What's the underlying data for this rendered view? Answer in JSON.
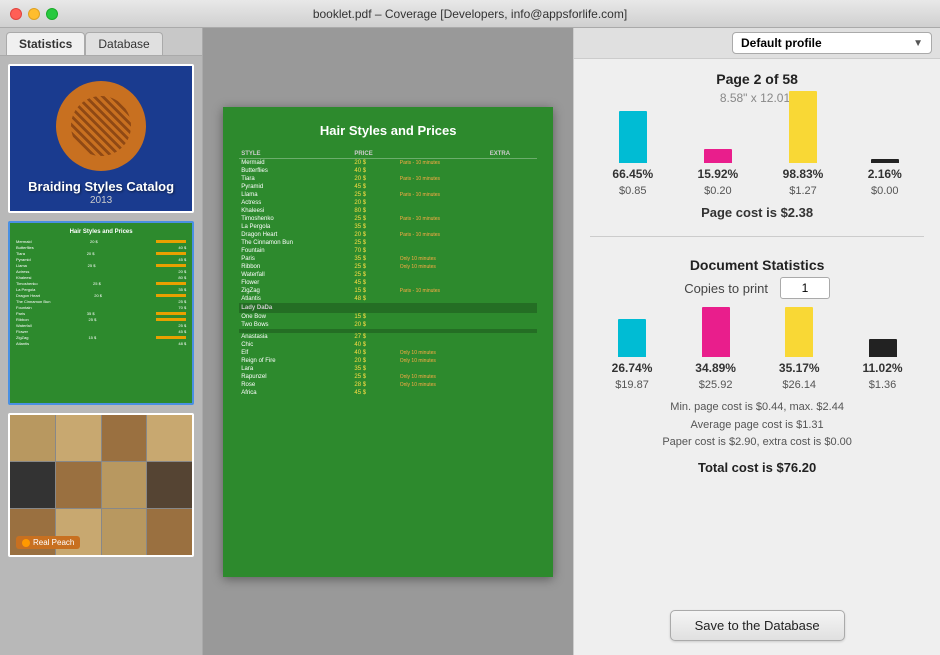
{
  "window": {
    "title": "booklet.pdf – Coverage [Developers, info@appsforlife.com]"
  },
  "tabs": {
    "statistics": "Statistics",
    "database": "Database"
  },
  "profile": {
    "label": "Default profile"
  },
  "thumbnails": [
    {
      "id": "cover",
      "type": "cover",
      "title": "Braiding Styles Catalog",
      "year": "2013"
    },
    {
      "id": "page2",
      "type": "page",
      "title": "Hair Styles and Prices"
    },
    {
      "id": "photos",
      "type": "photos",
      "badge": "Real Peach"
    }
  ],
  "preview": {
    "title": "Hair Styles and Prices",
    "items": [
      {
        "name": "Mermaid",
        "price": "20 $",
        "note": "Paris - 10 minutes"
      },
      {
        "name": "Butterflies",
        "price": "40 $",
        "note": ""
      },
      {
        "name": "Tiara",
        "price": "20 $",
        "note": "Paris - 10 minutes"
      },
      {
        "name": "Pyramid",
        "price": "45 $",
        "note": ""
      },
      {
        "name": "Llama",
        "price": "25 $",
        "note": "Paris - 10 minutes"
      },
      {
        "name": "Actress",
        "price": "20 $",
        "note": ""
      },
      {
        "name": "Khaleesi",
        "price": "80 $",
        "note": ""
      },
      {
        "name": "Timoshenko",
        "price": "25 $",
        "note": "Paris - 10 minutes"
      },
      {
        "name": "La Pergola",
        "price": "35 $",
        "note": ""
      },
      {
        "name": "Dragon Heart",
        "price": "20 $",
        "note": "Paris - 10 minutes"
      },
      {
        "name": "The Cinnamon Bun",
        "price": "25 $",
        "note": ""
      },
      {
        "name": "Fountain",
        "price": "70 $",
        "note": ""
      },
      {
        "name": "Paris",
        "price": "35 $",
        "note": "Only 10 minutes"
      },
      {
        "name": "Ribbon",
        "price": "25 $",
        "note": "Only 10 minutes"
      },
      {
        "name": "Waterfall",
        "price": "25 $",
        "note": ""
      },
      {
        "name": "Flower",
        "price": "45 $",
        "note": ""
      },
      {
        "name": "ZigZag",
        "price": "15 $",
        "note": "Paris - 10 minutes"
      },
      {
        "name": "Atlantis",
        "price": "48 $",
        "note": ""
      },
      {
        "section": "Lady DaDa"
      },
      {
        "name": "One Bow",
        "price": "15 $",
        "note": ""
      },
      {
        "name": "Two Bows",
        "price": "20 $",
        "note": ""
      },
      {
        "section": ""
      },
      {
        "name": "Anastasia",
        "price": "27 $",
        "note": ""
      },
      {
        "name": "Chic",
        "price": "40 $",
        "note": ""
      },
      {
        "name": "Elf",
        "price": "40 $",
        "note": "Only 10 minutes"
      },
      {
        "name": "Reign of Fire",
        "price": "20 $",
        "note": "Only 10 minutes"
      },
      {
        "name": "Lara",
        "price": "35 $",
        "note": ""
      },
      {
        "name": "Rapunzel",
        "price": "25 $",
        "note": "Only 10 minutes"
      },
      {
        "name": "Rose",
        "price": "28 $",
        "note": "Only 10 minutes"
      },
      {
        "name": "Africa",
        "price": "45 $",
        "note": ""
      }
    ]
  },
  "page_info": {
    "section_title": "Page 2 of 58",
    "dimensions": "8.58\" x 12.01\"",
    "colors": [
      {
        "id": "cyan",
        "pct": "66.45%",
        "cost": "$0.85"
      },
      {
        "id": "magenta",
        "pct": "15.92%",
        "cost": "$0.20"
      },
      {
        "id": "yellow",
        "pct": "98.83%",
        "cost": "$1.27"
      },
      {
        "id": "black",
        "pct": "2.16%",
        "cost": "$0.00"
      }
    ],
    "page_cost": "Page cost is $2.38"
  },
  "doc_stats": {
    "section_title": "Document Statistics",
    "copies_label": "Copies to print",
    "copies_value": "1",
    "colors": [
      {
        "id": "cyan",
        "pct": "26.74%",
        "cost": "$19.87"
      },
      {
        "id": "magenta",
        "pct": "34.89%",
        "cost": "$25.92"
      },
      {
        "id": "yellow",
        "pct": "35.17%",
        "cost": "$26.14"
      },
      {
        "id": "black",
        "pct": "11.02%",
        "cost": "$1.36"
      }
    ],
    "min_max": "Min. page cost is $0.44, max. $2.44",
    "average": "Average page cost is $1.31",
    "paper_cost": "Paper cost is $2.90, extra cost is $0.00",
    "total": "Total cost is $76.20"
  },
  "save_button": "Save to the Database"
}
